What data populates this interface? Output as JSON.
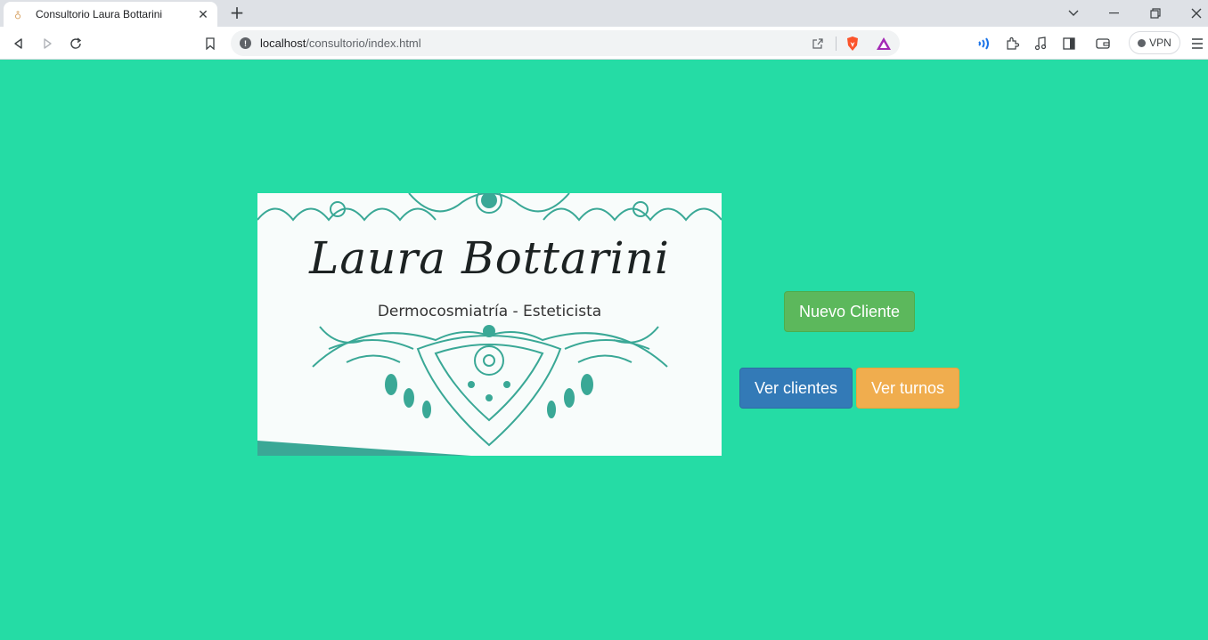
{
  "browser": {
    "tab": {
      "title": "Consultorio Laura Bottarini",
      "favicon": "leaf-favicon-icon"
    },
    "url": {
      "host": "localhost",
      "path": "/consultorio/index.html"
    },
    "vpn_label": "VPN"
  },
  "logo": {
    "name": "Laura Bottarini",
    "subtitle": "Dermocosmiatría - Esteticista",
    "accent_color": "#3aa896"
  },
  "actions": {
    "new_client": "Nuevo Cliente",
    "view_clients": "Ver clientes",
    "view_turns": "Ver turnos"
  },
  "colors": {
    "background": "#25dca5",
    "success": "#5cb85c",
    "primary": "#337ab7",
    "warning": "#f0ad4e"
  }
}
